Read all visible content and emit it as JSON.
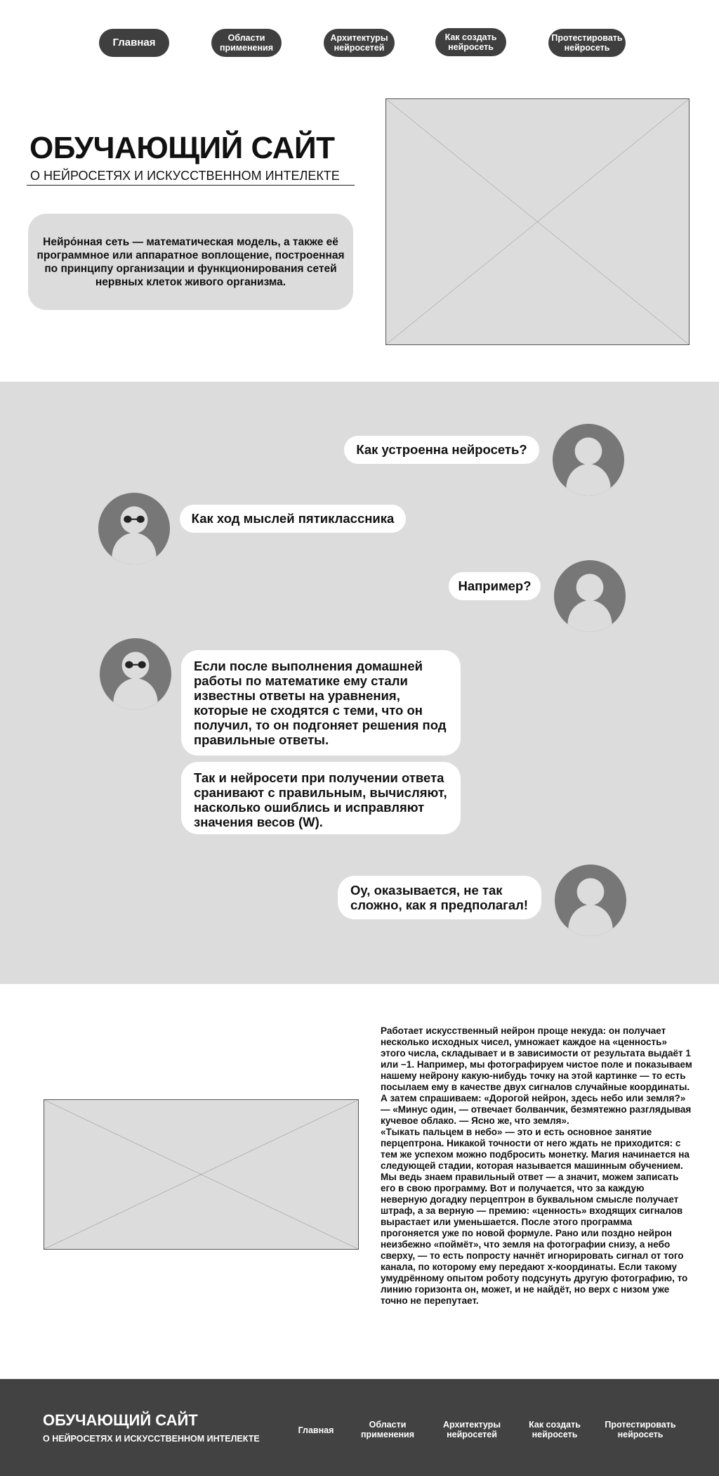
{
  "nav": {
    "items": [
      {
        "label": "Главная"
      },
      {
        "label": "Области применения"
      },
      {
        "label": "Архитектуры нейросетей"
      },
      {
        "label": "Как создать нейросеть"
      },
      {
        "label": "Протестировать нейросеть"
      }
    ]
  },
  "hero": {
    "title": "ОБУЧАЮЩИЙ САЙТ",
    "subtitle": "О НЕЙРОСЕТЯХ И ИСКУССТВЕННОМ ИНТЕЛЕКТЕ",
    "description": "Нейро́нная сеть — математическая модель, а также её программное или аппаратное воплощение, построенная по принципу организации и функционирования сетей нервных клеток живого организма."
  },
  "chat": {
    "messages": [
      {
        "text": "Как устроенна нейросеть?"
      },
      {
        "text": "Как ход мыслей пятиклассника"
      },
      {
        "text": "Например?"
      },
      {
        "text": "Если после выполнения домашней работы по математике ему стали известны ответы на уравнения, которые не сходятся с теми, что он получил, то он подгоняет решения под правильные ответы."
      },
      {
        "text": "Так и нейросети при получении ответа сранивают с правильным, вычисляют, насколько ошиблись и исправляют значения весов (W)."
      },
      {
        "text": "Оу, оказывается, не так сложно, как я предполагал!"
      }
    ]
  },
  "article": {
    "paragraph1": "Работает искусственный нейрон проще некуда: он получает несколько исходных чисел, умножает каждое на «ценность» этого числа, складывает и в зависимости от результата выдаёт 1 или −1. Например, мы фотографируем чистое поле и показываем нашему нейрону какую-нибудь точку на этой картинке — то есть посылаем ему в качестве двух сигналов случайные координаты. А затем спрашиваем: «Дорогой нейрон, здесь небо или земля?» — «Минус один, — отвечает болванчик, безмятежно разглядывая кучевое облако. — Ясно же, что земля».",
    "paragraph2": "«Тыкать пальцем в небо» — это и есть основное занятие перцептрона. Никакой точности от него ждать не приходится: с тем же успехом можно подбросить монетку. Магия начинается на следующей стадии, которая называется машинным обучением. Мы ведь знаем правильный ответ — а значит, можем записать его в свою программу. Вот и получается, что за каждую неверную догадку перцептрон в буквальном смысле получает штраф, а за верную — премию: «ценность» входящих сигналов вырастает или уменьшается. После этого программа прогоняется уже по новой формуле. Рано или поздно нейрон неизбежно «поймёт», что земля на фотографии снизу, а небо сверху, — то есть попросту начнёт игнорировать сигнал от того канала, по которому ему передают x-координаты. Если такому умудрённому опытом роботу подсунуть другую фотографию, то линию горизонта он, может, и не найдёт, но верх с низом уже точно не перепутает."
  },
  "footer": {
    "title": "ОБУЧАЮЩИЙ САЙТ",
    "subtitle": "О НЕЙРОСЕТЯХ И ИСКУССТВЕННОМ ИНТЕЛЕКТЕ",
    "links": [
      {
        "label": "Главная"
      },
      {
        "label": "Области применения"
      },
      {
        "label": "Архитектуры нейросетей"
      },
      {
        "label": "Как создать нейросеть"
      },
      {
        "label": "Протестировать нейросеть"
      }
    ]
  },
  "colors": {
    "nav_bg": "#3f3f3f",
    "section_gray": "#dcdcdc",
    "avatar_gray": "#777777",
    "footer_bg": "#424242"
  }
}
